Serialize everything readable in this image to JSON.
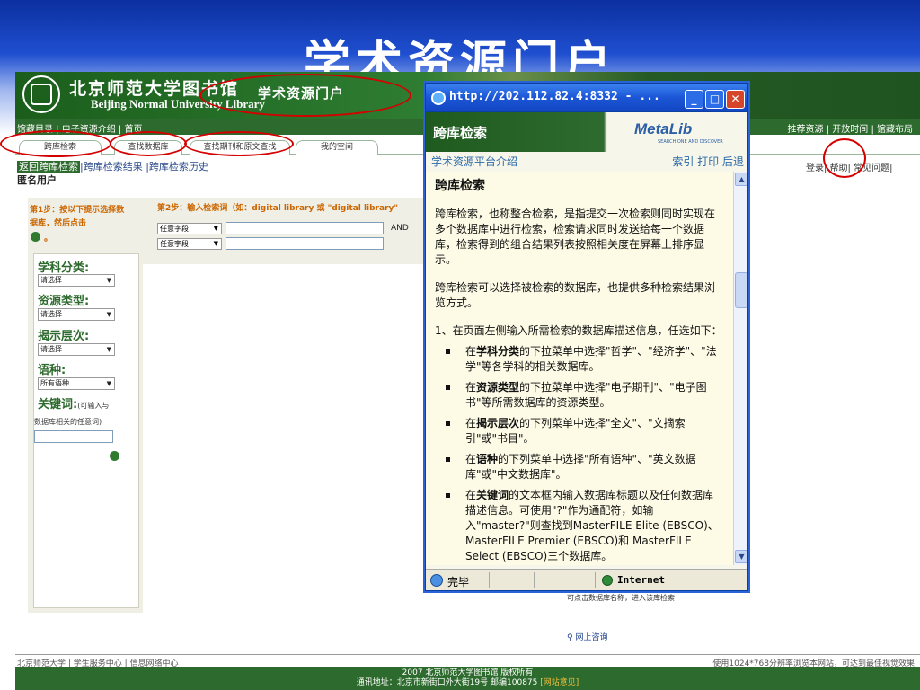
{
  "slide": {
    "title": "学术资源门户"
  },
  "library": {
    "logo_cn": "北京师范大学图书馆",
    "logo_en": "Beijing Normal University Library",
    "portal_banner": "学术资源门户",
    "topnav_left": "馆藏目录 | 电子资源介绍 | 首页",
    "topnav_right": "推荐资源 | 开放时间 | 馆藏布局",
    "tabs": [
      "跨库检索",
      "查找数据库",
      "查找期刊和原文查找",
      "我的空间"
    ],
    "subnav_active": "返回跨库检索",
    "subnav_rest": "|跨库检索结果 |跨库检索历史",
    "anon_user": "匿名用户",
    "login_links": "登录| 帮助| 常见问题|",
    "step1_title": "第1步：按以下提示选择数据库，然后点击",
    "step1_dot": "。",
    "subject_label": "学科分类:",
    "subject_value": "请选择",
    "type_label": "资源类型:",
    "type_value": "请选择",
    "level_label": "揭示层次:",
    "level_value": "请选择",
    "lang_label": "语种:",
    "lang_value": "所有语种",
    "keyword_label": "关键词:",
    "keyword_hint": "(可输入与",
    "keyword_hint2": "数据库相关的任意词)",
    "step2_title": "第2步：输入检索词（如：digital library 或 \"digital library\"",
    "field1": "任意字段",
    "field2": "任意字段",
    "and_label": "AND",
    "db_note": "可点击数据库名称，进入该库检索",
    "consult": "网上咨询",
    "footer_left": "北京师范大学 | 学生服务中心 | 信息网络中心",
    "footer_right": "使用1024*768分辨率浏览本网站，可达到最佳视觉效果",
    "footer_copyright": "2007 北京师范大学图书馆 版权所有",
    "footer_address": "通讯地址：北京市新街口外大街19号 邮编100875",
    "footer_link": "[网站意见]"
  },
  "popup": {
    "url": "http://202.112.82.4:8332 - ...",
    "head_title": "跨库检索",
    "metalib": "MetaLib",
    "metalib_sub": "SEARCH ONE AND DISCOVER",
    "subnav_left": "学术资源平台介绍",
    "subnav_right": "索引 打印 后退",
    "body_title": "跨库检索",
    "para1": "跨库检索，也称整合检索，是指提交一次检索则同时实现在多个数据库中进行检索，检索请求同时发送给每一个数据库，检索得到的组合结果列表按照相关度在屏幕上排序显示。",
    "para2": "跨库检索可以选择被检索的数据库，也提供多种检索结果浏览方式。",
    "para3": "1、在页面左侧输入所需检索的数据库描述信息，任选如下：",
    "bullets": [
      {
        "pre": "在",
        "bold": "学科分类",
        "post": "的下拉菜单中选择\"哲学\"、\"经济学\"、\"法学\"等各学科的相关数据库。"
      },
      {
        "pre": "在",
        "bold": "资源类型",
        "post": "的下拉菜单中选择\"电子期刊\"、\"电子图书\"等所需数据库的资源类型。"
      },
      {
        "pre": "在",
        "bold": "揭示层次",
        "post": "的下列菜单中选择\"全文\"、\"文摘索引\"或\"书目\"。"
      },
      {
        "pre": "在",
        "bold": "语种",
        "post": "的下列菜单中选择\"所有语种\"、\"英文数据库\"或\"中文数据库\"。"
      },
      {
        "pre": "在",
        "bold": "关键词",
        "post": "的文本框内输入数据库标题以及任何数据库描述信息。可使用\"?\"作为通配符，如输入\"master?\"则查找到MasterFILE Elite (EBSCO)、MasterFILE Premier (EBSCO)和 MasterFILE Select (EBSCO)三个数据库。"
      }
    ],
    "status_text": "完毕",
    "zone_text": "Internet"
  },
  "colors": {
    "annotation": "#d40000",
    "library_green": "#2d6a2d",
    "xp_blue": "#1c56d6"
  }
}
